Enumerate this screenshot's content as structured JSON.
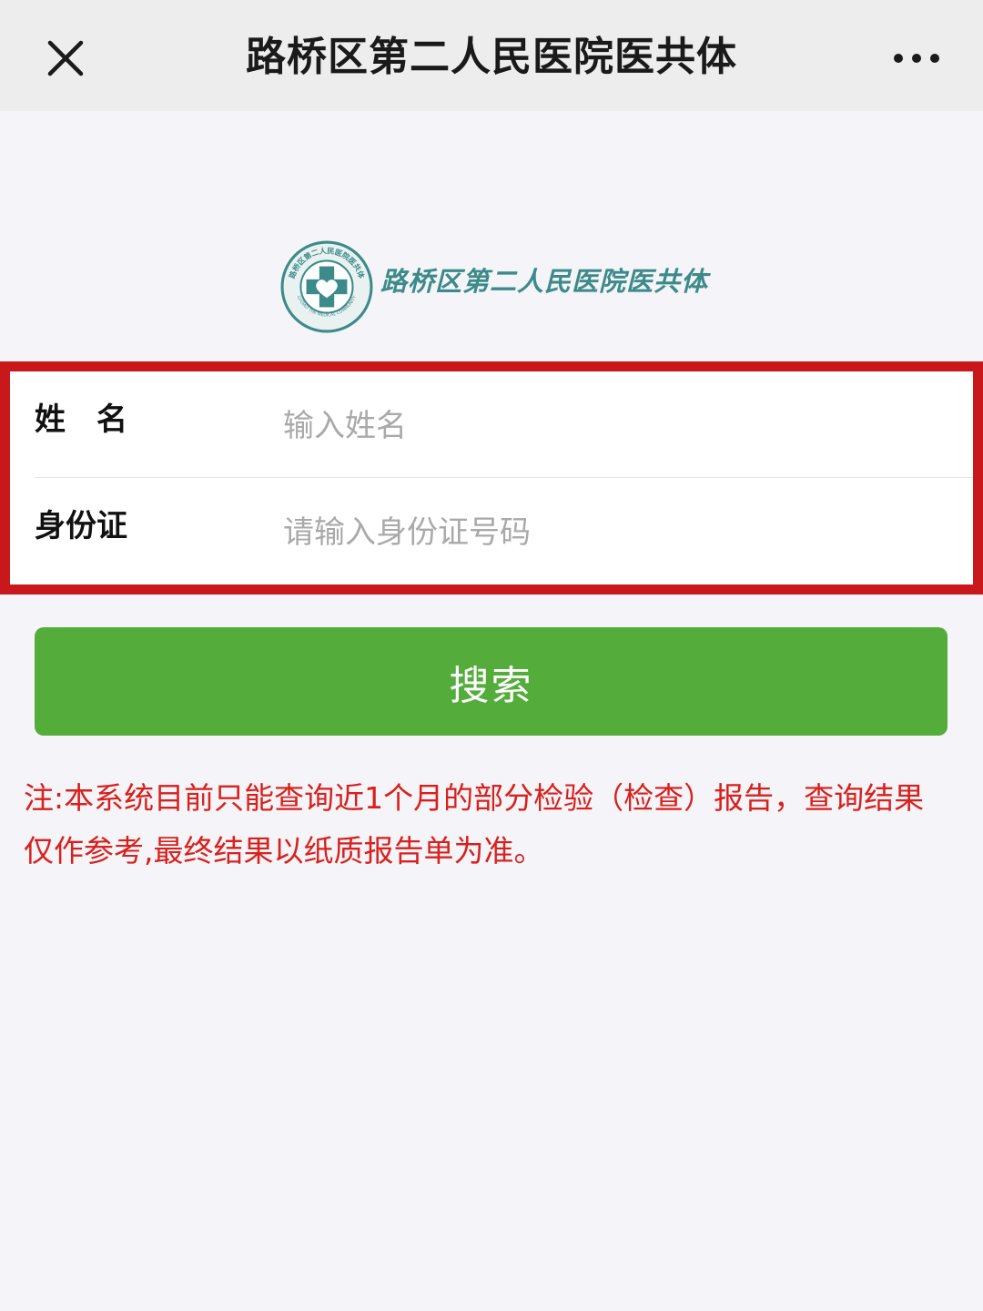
{
  "nav": {
    "title": "路桥区第二人民医院医共体"
  },
  "logo": {
    "text": "路桥区第二人民医院医共体",
    "ring_text": "路桥区第二人民医院医共体",
    "ring_text_en": "LUQIAO THE MEDICAL COMMUNITY"
  },
  "form": {
    "name_label": "姓　名",
    "name_placeholder": "输入姓名",
    "id_label": "身份证",
    "id_placeholder": "请输入身份证号码"
  },
  "search": {
    "label": "搜索"
  },
  "notice": {
    "text": "注:本系统目前只能查询近1个月的部分检验（检查）报告，查询结果仅作参考,最终结果以纸质报告单为准。"
  },
  "colors": {
    "nav_bg": "#ededed",
    "page_bg": "#f5f4f8",
    "highlight_border": "#c8181c",
    "button": "#54ac3b",
    "notice": "#d8201c",
    "logo": "#3c8a8a"
  },
  "icons": {
    "close": "close-icon",
    "more": "more-dots-icon",
    "logo": "hospital-cross-heart-logo"
  }
}
